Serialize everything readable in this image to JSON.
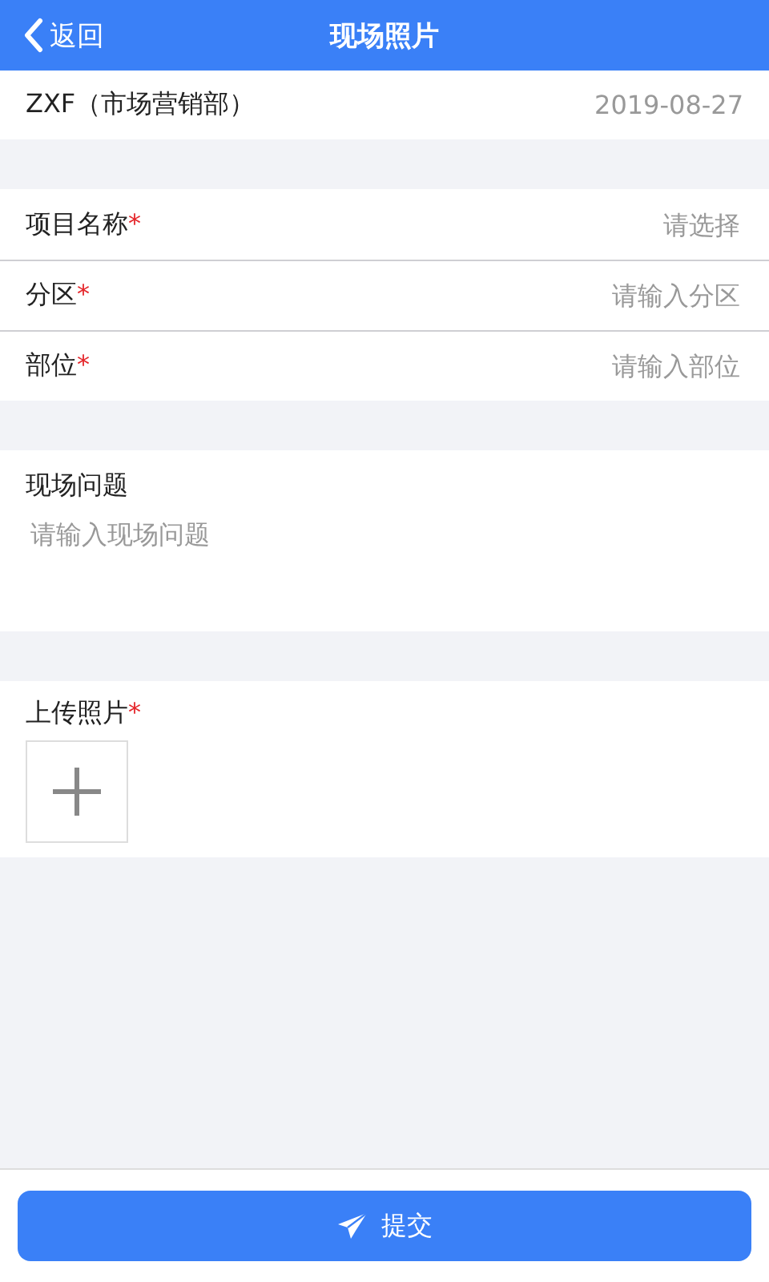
{
  "header": {
    "back": "返回",
    "title": "现场照片"
  },
  "user": {
    "name": "ZXF（市场营销部）",
    "date": "2019-08-27"
  },
  "fields": [
    {
      "label": "项目名称",
      "required": true,
      "placeholder": "请选择"
    },
    {
      "label": "分区",
      "required": true,
      "placeholder": "请输入分区"
    },
    {
      "label": "部位",
      "required": true,
      "placeholder": "请输入部位"
    }
  ],
  "problem": {
    "label": "现场问题",
    "placeholder": "请输入现场问题"
  },
  "upload": {
    "label": "上传照片",
    "required": true
  },
  "submit": "提交",
  "required_mark": "*"
}
